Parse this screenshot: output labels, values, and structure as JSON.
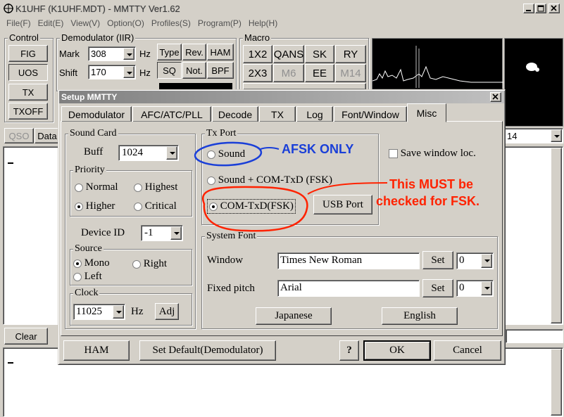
{
  "main": {
    "title": "K1UHF (K1UHF.MDT) - MMTTY Ver1.62",
    "menu": [
      "File(F)",
      "Edit(E)",
      "View(V)",
      "Option(O)",
      "Profiles(S)",
      "Program(P)",
      "Help(H)"
    ],
    "control": {
      "label": "Control",
      "buttons": [
        "FIG",
        "UOS",
        "TX",
        "TXOFF"
      ]
    },
    "demod": {
      "label": "Demodulator (IIR)",
      "mark_label": "Mark",
      "mark_value": "308",
      "shift_label": "Shift",
      "shift_value": "170",
      "hz": "Hz",
      "buttons": [
        "Type",
        "Rev.",
        "HAM",
        "SQ",
        "Not.",
        "BPF"
      ]
    },
    "macro": {
      "label": "Macro",
      "buttons": [
        "1X2",
        "QANS",
        "SK",
        "RY",
        "2X3",
        "M6",
        "EE",
        "M14"
      ]
    },
    "qso_label": "QSO",
    "data_label": "Data",
    "right_value": "14",
    "clear_label": "Clear"
  },
  "dialog": {
    "title": "Setup MMTTY",
    "tabs": [
      "Demodulator",
      "AFC/ATC/PLL",
      "Decode",
      "TX",
      "Log",
      "Font/Window",
      "Misc"
    ],
    "sound_card": {
      "label": "Sound Card",
      "buff_label": "Buff",
      "buff_value": "1024",
      "priority_label": "Priority",
      "priority_options": [
        "Normal",
        "Highest",
        "Higher",
        "Critical"
      ],
      "device_label": "Device ID",
      "device_value": "-1",
      "source_label": "Source",
      "source_options": [
        "Mono",
        "Right",
        "Left"
      ],
      "clock_label": "Clock",
      "clock_value": "11025",
      "clock_unit": "Hz",
      "adj_label": "Adj"
    },
    "tx_port": {
      "label": "Tx Port",
      "options": [
        "Sound",
        "Sound + COM-TxD (FSK)",
        "COM-TxD(FSK)"
      ],
      "usb_label": "USB Port"
    },
    "save_window_label": "Save window loc.",
    "system_font": {
      "label": "System Font",
      "window_label": "Window",
      "window_font": "Times New Roman",
      "fixed_label": "Fixed pitch",
      "fixed_font": "Arial",
      "set_label": "Set",
      "charset_value": "0",
      "japanese_label": "Japanese",
      "english_label": "English"
    },
    "footer": {
      "ham": "HAM",
      "set_default": "Set Default(Demodulator)",
      "help": "?",
      "ok": "OK",
      "cancel": "Cancel"
    }
  },
  "annotations": {
    "afsk": "AFSK ONLY",
    "must_line1": "This MUST be",
    "must_line2": "checked for FSK.",
    "blue": "#1a3fd8",
    "red": "#ff2200"
  }
}
